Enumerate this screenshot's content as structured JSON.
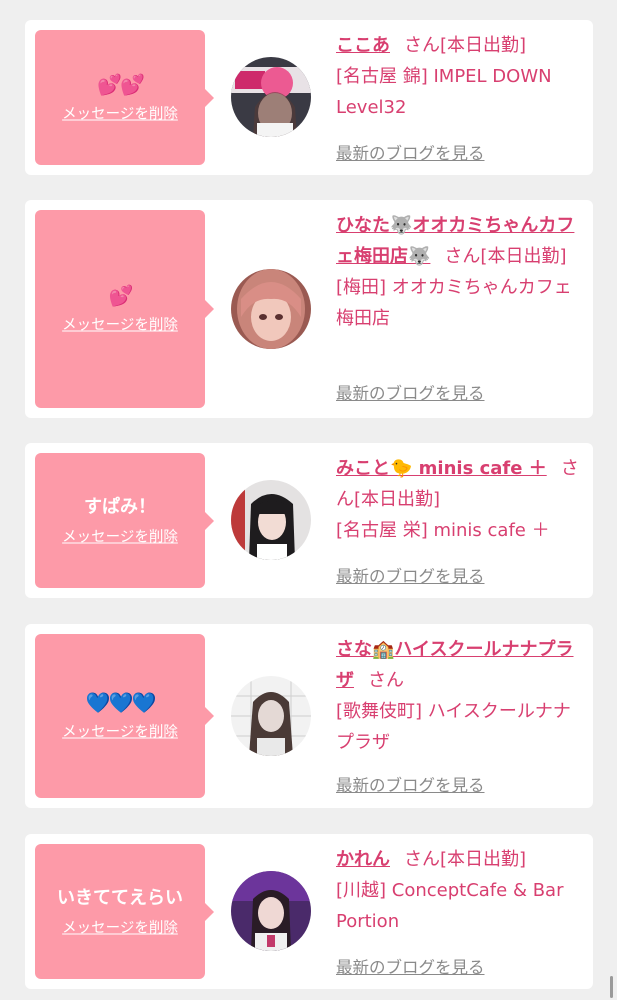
{
  "labels": {
    "delete": "メッセージを削除",
    "blog": "最新のブログを見る",
    "honorific": "さん"
  },
  "cards": [
    {
      "message": "💕💕",
      "message_is_emoji": true,
      "name": "ここあ",
      "status": "[本日出勤]",
      "shop": "[名古屋 錦] IMPEL DOWN Level32",
      "avatar_icon": "profile-photo"
    },
    {
      "message": "💕",
      "message_is_emoji": true,
      "name": "ひなた🐺オオカミちゃんカフェ梅田店🐺",
      "status": "[本日出勤]",
      "shop": "[梅田] オオカミちゃんカフェ梅田店",
      "avatar_icon": "profile-photo"
    },
    {
      "message": "すぱみ！",
      "message_is_emoji": false,
      "name": "みこと🐤 minis cafe ＋",
      "status": "[本日出勤]",
      "shop": "[名古屋 栄] minis cafe ＋",
      "avatar_icon": "profile-photo"
    },
    {
      "message": "💙💙💙",
      "message_is_emoji": true,
      "name": "さな🏫ハイスクールナナプラザ",
      "status": "",
      "shop": "[歌舞伎町] ハイスクールナナプラザ",
      "avatar_icon": "profile-photo"
    },
    {
      "message": "いきててえらい",
      "message_is_emoji": false,
      "name": "かれん",
      "status": "[本日出勤]",
      "shop": "[川越] ConceptCafe & Bar Portion",
      "avatar_icon": "profile-photo"
    }
  ]
}
